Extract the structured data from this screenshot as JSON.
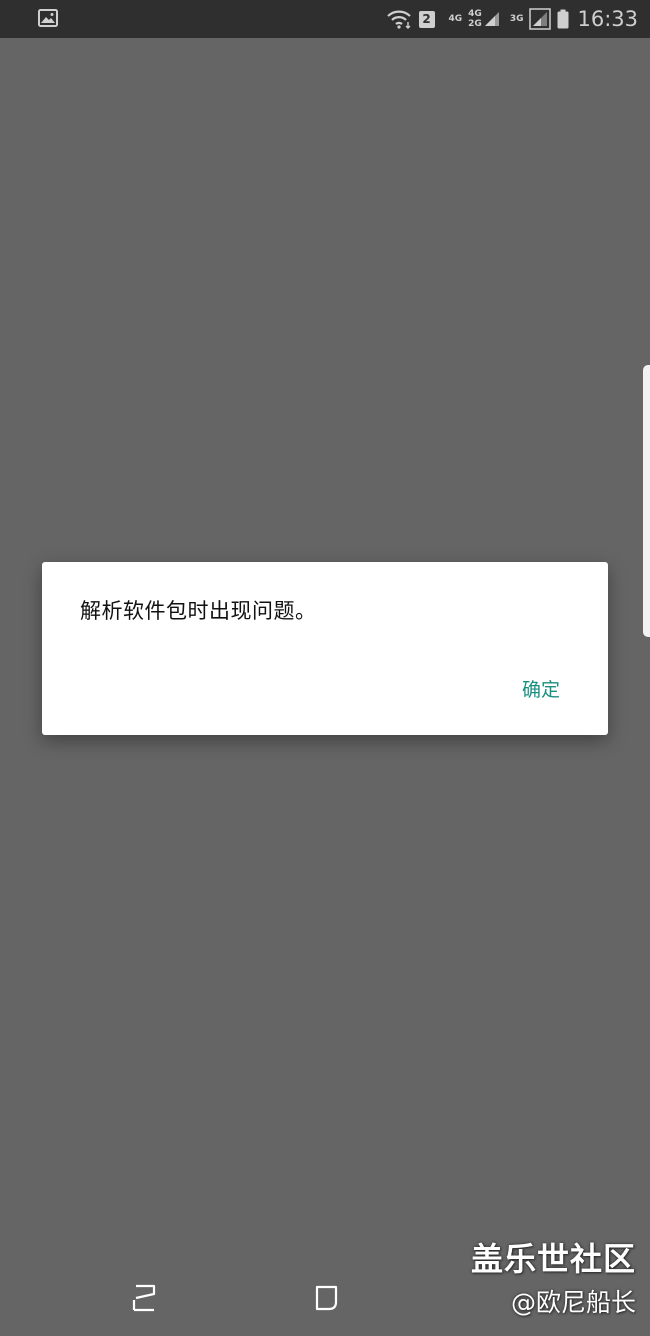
{
  "status_bar": {
    "sim_slot": "2",
    "net_1": "4G",
    "net_2_top": "4G",
    "net_2_bottom": "2G",
    "net_3": "3G",
    "time": "16:33",
    "icons": [
      "image-icon",
      "wifi-icon",
      "signal-icon",
      "battery-icon"
    ]
  },
  "dialog": {
    "message": "解析软件包时出现问题。",
    "confirm_label": "确定",
    "accent_color": "#1a8f82"
  },
  "nav_bar": {
    "icons": [
      "recents-icon",
      "home-icon"
    ]
  },
  "watermark": {
    "line1": "盖乐世社区",
    "line2": "@欧尼船长"
  }
}
